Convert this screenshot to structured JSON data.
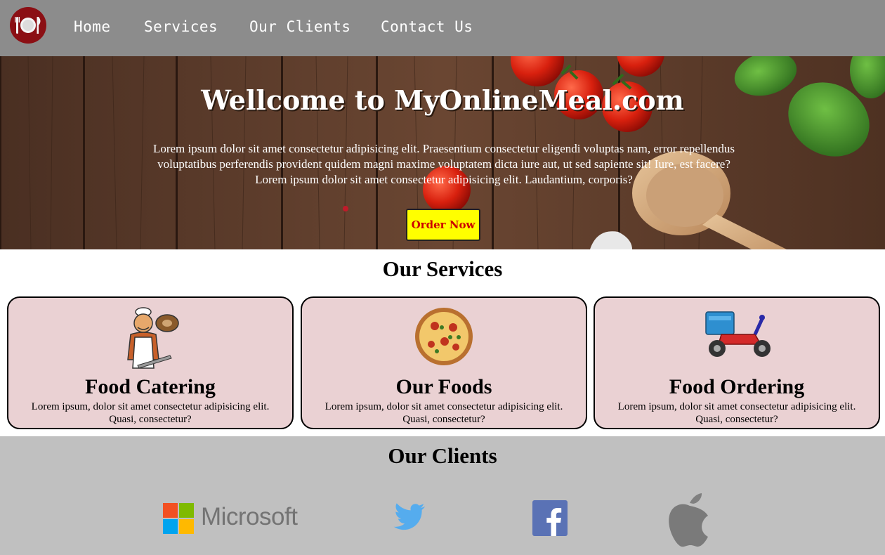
{
  "nav": {
    "logo_icon": "plate-cutlery-icon",
    "links": [
      {
        "label": "Home"
      },
      {
        "label": "Services"
      },
      {
        "label": "Our Clients"
      },
      {
        "label": "Contact Us"
      }
    ]
  },
  "hero": {
    "title": "Wellcome to MyOnlineMeal.com",
    "paragraph_1": "Lorem ipsum dolor sit amet consectetur adipisicing elit. Praesentium consectetur eligendi voluptas nam, error repellendus voluptatibus perferendis provident quidem magni maxime voluptatem dicta iure aut, ut sed sapiente sit! Iure, est facere?",
    "paragraph_2": "Lorem ipsum dolor sit amet consectetur adipisicing elit. Laudantium, corporis?",
    "order_button": "Order Now"
  },
  "services": {
    "title": "Our Services",
    "cards": [
      {
        "icon": "chef-icon",
        "title": "Food Catering",
        "text": "Lorem ipsum, dolor sit amet consectetur adipisicing elit. Quasi, consectetur?"
      },
      {
        "icon": "pizza-icon",
        "title": "Our Foods",
        "text": "Lorem ipsum, dolor sit amet consectetur adipisicing elit. Quasi, consectetur?"
      },
      {
        "icon": "delivery-scooter-icon",
        "title": "Food Ordering",
        "text": "Lorem ipsum, dolor sit amet consectetur adipisicing elit. Quasi, consectetur?"
      }
    ]
  },
  "clients": {
    "title": "Our Clients",
    "logos": [
      {
        "name": "microsoft-logo",
        "label": "Microsoft"
      },
      {
        "name": "twitter-logo"
      },
      {
        "name": "facebook-logo"
      },
      {
        "name": "apple-logo"
      }
    ]
  },
  "colors": {
    "nav_bg": "#8c8c8c",
    "card_bg": "#ead1d3",
    "clients_bg": "#c0c0c0",
    "button_bg": "#ffff00",
    "button_text": "#cc0000"
  }
}
